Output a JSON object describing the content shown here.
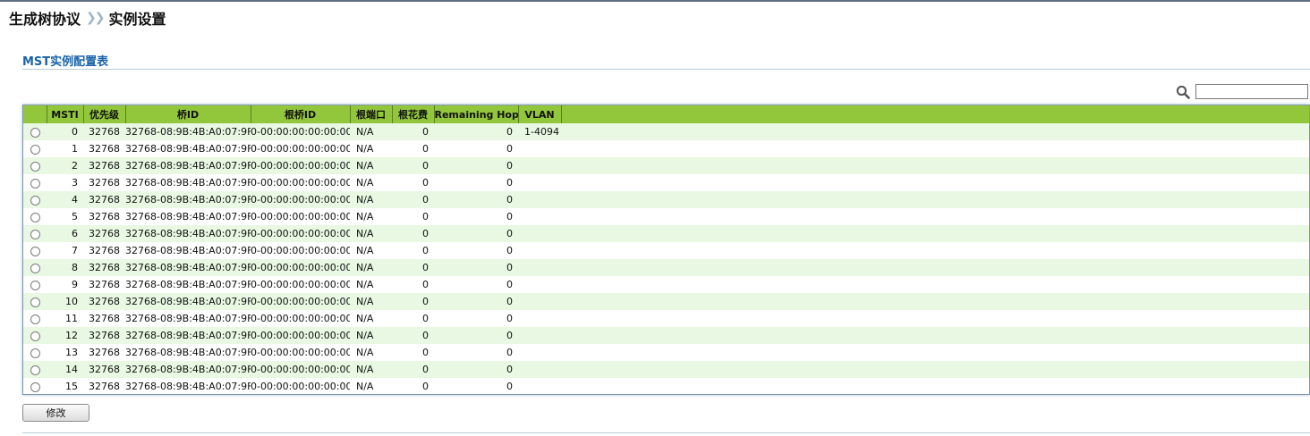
{
  "breadcrumb": {
    "parent": "生成树协议",
    "separator": "❯❯",
    "current": "实例设置"
  },
  "section": {
    "title": "MST实例配置表"
  },
  "search": {
    "value": "",
    "icon": "search-icon"
  },
  "table": {
    "columns": [
      "",
      "MSTI",
      "优先级",
      "桥ID",
      "根桥ID",
      "根端口",
      "根花费",
      "Remaining Hop",
      "VLAN"
    ],
    "rows": [
      {
        "msti": "0",
        "priority": "32768",
        "bridge_id": "32768-08:9B:4B:A0:07:9F",
        "root_bridge_id": "0-00:00:00:00:00:00",
        "root_port": "N/A",
        "root_cost": "0",
        "remaining_hop": "0",
        "vlan": "1-4094"
      },
      {
        "msti": "1",
        "priority": "32768",
        "bridge_id": "32768-08:9B:4B:A0:07:9F",
        "root_bridge_id": "0-00:00:00:00:00:00",
        "root_port": "N/A",
        "root_cost": "0",
        "remaining_hop": "0",
        "vlan": ""
      },
      {
        "msti": "2",
        "priority": "32768",
        "bridge_id": "32768-08:9B:4B:A0:07:9F",
        "root_bridge_id": "0-00:00:00:00:00:00",
        "root_port": "N/A",
        "root_cost": "0",
        "remaining_hop": "0",
        "vlan": ""
      },
      {
        "msti": "3",
        "priority": "32768",
        "bridge_id": "32768-08:9B:4B:A0:07:9F",
        "root_bridge_id": "0-00:00:00:00:00:00",
        "root_port": "N/A",
        "root_cost": "0",
        "remaining_hop": "0",
        "vlan": ""
      },
      {
        "msti": "4",
        "priority": "32768",
        "bridge_id": "32768-08:9B:4B:A0:07:9F",
        "root_bridge_id": "0-00:00:00:00:00:00",
        "root_port": "N/A",
        "root_cost": "0",
        "remaining_hop": "0",
        "vlan": ""
      },
      {
        "msti": "5",
        "priority": "32768",
        "bridge_id": "32768-08:9B:4B:A0:07:9F",
        "root_bridge_id": "0-00:00:00:00:00:00",
        "root_port": "N/A",
        "root_cost": "0",
        "remaining_hop": "0",
        "vlan": ""
      },
      {
        "msti": "6",
        "priority": "32768",
        "bridge_id": "32768-08:9B:4B:A0:07:9F",
        "root_bridge_id": "0-00:00:00:00:00:00",
        "root_port": "N/A",
        "root_cost": "0",
        "remaining_hop": "0",
        "vlan": ""
      },
      {
        "msti": "7",
        "priority": "32768",
        "bridge_id": "32768-08:9B:4B:A0:07:9F",
        "root_bridge_id": "0-00:00:00:00:00:00",
        "root_port": "N/A",
        "root_cost": "0",
        "remaining_hop": "0",
        "vlan": ""
      },
      {
        "msti": "8",
        "priority": "32768",
        "bridge_id": "32768-08:9B:4B:A0:07:9F",
        "root_bridge_id": "0-00:00:00:00:00:00",
        "root_port": "N/A",
        "root_cost": "0",
        "remaining_hop": "0",
        "vlan": ""
      },
      {
        "msti": "9",
        "priority": "32768",
        "bridge_id": "32768-08:9B:4B:A0:07:9F",
        "root_bridge_id": "0-00:00:00:00:00:00",
        "root_port": "N/A",
        "root_cost": "0",
        "remaining_hop": "0",
        "vlan": ""
      },
      {
        "msti": "10",
        "priority": "32768",
        "bridge_id": "32768-08:9B:4B:A0:07:9F",
        "root_bridge_id": "0-00:00:00:00:00:00",
        "root_port": "N/A",
        "root_cost": "0",
        "remaining_hop": "0",
        "vlan": ""
      },
      {
        "msti": "11",
        "priority": "32768",
        "bridge_id": "32768-08:9B:4B:A0:07:9F",
        "root_bridge_id": "0-00:00:00:00:00:00",
        "root_port": "N/A",
        "root_cost": "0",
        "remaining_hop": "0",
        "vlan": ""
      },
      {
        "msti": "12",
        "priority": "32768",
        "bridge_id": "32768-08:9B:4B:A0:07:9F",
        "root_bridge_id": "0-00:00:00:00:00:00",
        "root_port": "N/A",
        "root_cost": "0",
        "remaining_hop": "0",
        "vlan": ""
      },
      {
        "msti": "13",
        "priority": "32768",
        "bridge_id": "32768-08:9B:4B:A0:07:9F",
        "root_bridge_id": "0-00:00:00:00:00:00",
        "root_port": "N/A",
        "root_cost": "0",
        "remaining_hop": "0",
        "vlan": ""
      },
      {
        "msti": "14",
        "priority": "32768",
        "bridge_id": "32768-08:9B:4B:A0:07:9F",
        "root_bridge_id": "0-00:00:00:00:00:00",
        "root_port": "N/A",
        "root_cost": "0",
        "remaining_hop": "0",
        "vlan": ""
      },
      {
        "msti": "15",
        "priority": "32768",
        "bridge_id": "32768-08:9B:4B:A0:07:9F",
        "root_bridge_id": "0-00:00:00:00:00:00",
        "root_port": "N/A",
        "root_cost": "0",
        "remaining_hop": "0",
        "vlan": ""
      }
    ]
  },
  "buttons": {
    "modify": "修改"
  },
  "colors": {
    "header_bg": "#93c73b",
    "row_alt_bg": "#e8f8e3",
    "section_title": "#1a63a9"
  }
}
